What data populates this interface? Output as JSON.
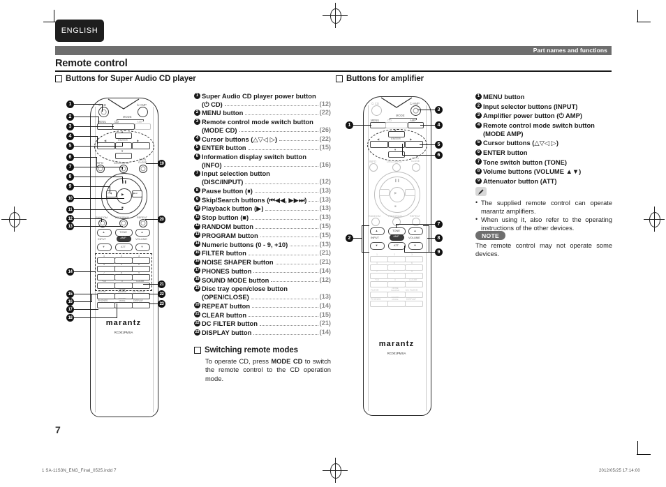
{
  "page": {
    "language_tab": "ENGLISH",
    "running_head": "Part names and functions",
    "section_title": "Remote control",
    "page_number": "7",
    "footer_left": "1 SA-11S3N_ENG_Final_0525.indd   7",
    "footer_date": "2012/05/25   17:14:00"
  },
  "left_column": {
    "heading": "Buttons for Super Audio CD player",
    "items": [
      {
        "n": "1",
        "label": "Super Audio CD player power button",
        "label2": "(⏻ CD)",
        "page": "(12)"
      },
      {
        "n": "2",
        "label": "MENU button",
        "label2": "",
        "page": "(22)"
      },
      {
        "n": "3",
        "label": "Remote control mode switch button",
        "label2": "(MODE CD)",
        "page": "(26)"
      },
      {
        "n": "4",
        "label": "Cursor buttons (△▽◁ ▷)",
        "label2": "",
        "page": "(22)"
      },
      {
        "n": "5",
        "label": "ENTER button",
        "label2": "",
        "page": "(15)"
      },
      {
        "n": "6",
        "label": "Information display switch button",
        "label2": "(INFO)",
        "page": "(16)"
      },
      {
        "n": "7",
        "label": "Input selection button",
        "label2": "(DISC/INPUT)",
        "page": "(12)"
      },
      {
        "n": "8",
        "label": "Pause button (⏸)",
        "label2": "",
        "page": "(13)"
      },
      {
        "n": "9",
        "label": "Skip/Search buttons (⏮◀◀, ▶▶⏭)",
        "label2": "",
        "page": "(13)"
      },
      {
        "n": "10",
        "label": "Playback button (▶)",
        "label2": "",
        "page": "(13)"
      },
      {
        "n": "11",
        "label": "Stop button (■)",
        "label2": "",
        "page": "(13)"
      },
      {
        "n": "12",
        "label": "RANDOM button",
        "label2": "",
        "page": "(15)"
      },
      {
        "n": "13",
        "label": "PROGRAM button",
        "label2": "",
        "page": "(15)"
      },
      {
        "n": "14",
        "label": "Numeric buttons (0 - 9, +10)",
        "label2": "",
        "page": "(13)"
      },
      {
        "n": "15",
        "label": "FILTER button",
        "label2": "",
        "page": "(21)"
      },
      {
        "n": "16",
        "label": "NOISE SHAPER button",
        "label2": "",
        "page": "(21)"
      },
      {
        "n": "17",
        "label": "PHONES button",
        "label2": "",
        "page": "(14)"
      },
      {
        "n": "18",
        "label": "SOUND MODE button",
        "label2": "",
        "page": "(12)"
      },
      {
        "n": "19",
        "label": "Disc tray open/close button",
        "label2": "(OPEN/CLOSE)",
        "page": "(13)"
      },
      {
        "n": "20",
        "label": "REPEAT button",
        "label2": "",
        "page": "(14)"
      },
      {
        "n": "21",
        "label": "CLEAR button",
        "label2": "",
        "page": "(15)"
      },
      {
        "n": "22",
        "label": "DC FILTER button",
        "label2": "",
        "page": "(21)"
      },
      {
        "n": "23",
        "label": "DISPLAY button",
        "label2": "",
        "page": "(14)"
      }
    ],
    "switching": {
      "heading": "Switching remote modes",
      "text_before": "To operate CD, press ",
      "text_bold": "MODE CD",
      "text_after": " to switch the remote control to the CD operation mode."
    }
  },
  "right_column": {
    "heading": "Buttons for amplifier",
    "items": [
      {
        "n": "1",
        "label": "MENU button",
        "label2": ""
      },
      {
        "n": "2",
        "label": "Input selector buttons (INPUT)",
        "label2": ""
      },
      {
        "n": "3",
        "label": "Amplifier power button (⏻  AMP)",
        "label2": ""
      },
      {
        "n": "4",
        "label": "Remote control mode switch button",
        "label2": "(MODE AMP)"
      },
      {
        "n": "5",
        "label": "Cursor buttons (△▽◁ ▷)",
        "label2": ""
      },
      {
        "n": "6",
        "label": "ENTER button",
        "label2": ""
      },
      {
        "n": "7",
        "label": "Tone switch button (TONE)",
        "label2": ""
      },
      {
        "n": "8",
        "label": "Volume buttons (VOLUME ▲▼)",
        "label2": ""
      },
      {
        "n": "9",
        "label": "Attenuator button (ATT)",
        "label2": ""
      }
    ],
    "tips": [
      "The supplied remote control can operate marantz amplifiers.",
      "When using it, also refer to the operating instructions of the other devices."
    ],
    "note_badge": "NOTE",
    "note_text": "The remote control may not operate some devices."
  },
  "remote_cd": {
    "brand": "marantz",
    "model": "RC001PMSA",
    "top_labels": {
      "cd_power": "⏻ CD",
      "amp_power": "⏻ AMP",
      "mode": "MODE",
      "mode_cd": "CD",
      "mode_amp": "AMP"
    },
    "keys": {
      "menu": "MENU",
      "enter": "ENTER",
      "info": "INFO",
      "disc_input": "DISC/INPUT",
      "open_close": "OPEN CLOSE",
      "random": "RANDOM",
      "program": "PROGRAM",
      "repeat": "REPEAT",
      "tone": "TONE",
      "input": "INPUT",
      "amp": "AMP",
      "volume": "VOLUME",
      "att": "ATT",
      "filter": "FILTER",
      "noise_shaper": "NOISE SHAPER",
      "dc_filter": "DC FILTER",
      "phones": "PHONES",
      "sound_mode": "SOUND MODE",
      "display": "DISPLAY",
      "clear": "CLEAR",
      "plus10": "+10",
      "zero": "0"
    },
    "numpad": [
      "1",
      "2",
      "3",
      "4",
      "5",
      "6",
      "7",
      "8",
      "9"
    ],
    "markers_left": [
      "1",
      "2",
      "3",
      "4",
      "5",
      "6",
      "7",
      "8",
      "9",
      "10",
      "11",
      "12",
      "13",
      "14",
      "15",
      "16",
      "17",
      "18"
    ],
    "markers_right": [
      "19",
      "20",
      "21",
      "22",
      "23"
    ]
  },
  "remote_amp": {
    "brand": "marantz",
    "model": "RC001PMSA",
    "markers_left": [
      "1",
      "2"
    ],
    "markers_right": [
      "3",
      "4",
      "5",
      "6",
      "7",
      "8",
      "9"
    ]
  },
  "colors": {
    "headbar": "#6e6e6e",
    "tab": "#1e1e1e",
    "leader": "#8d8d8d",
    "page_ref": "#888888"
  }
}
